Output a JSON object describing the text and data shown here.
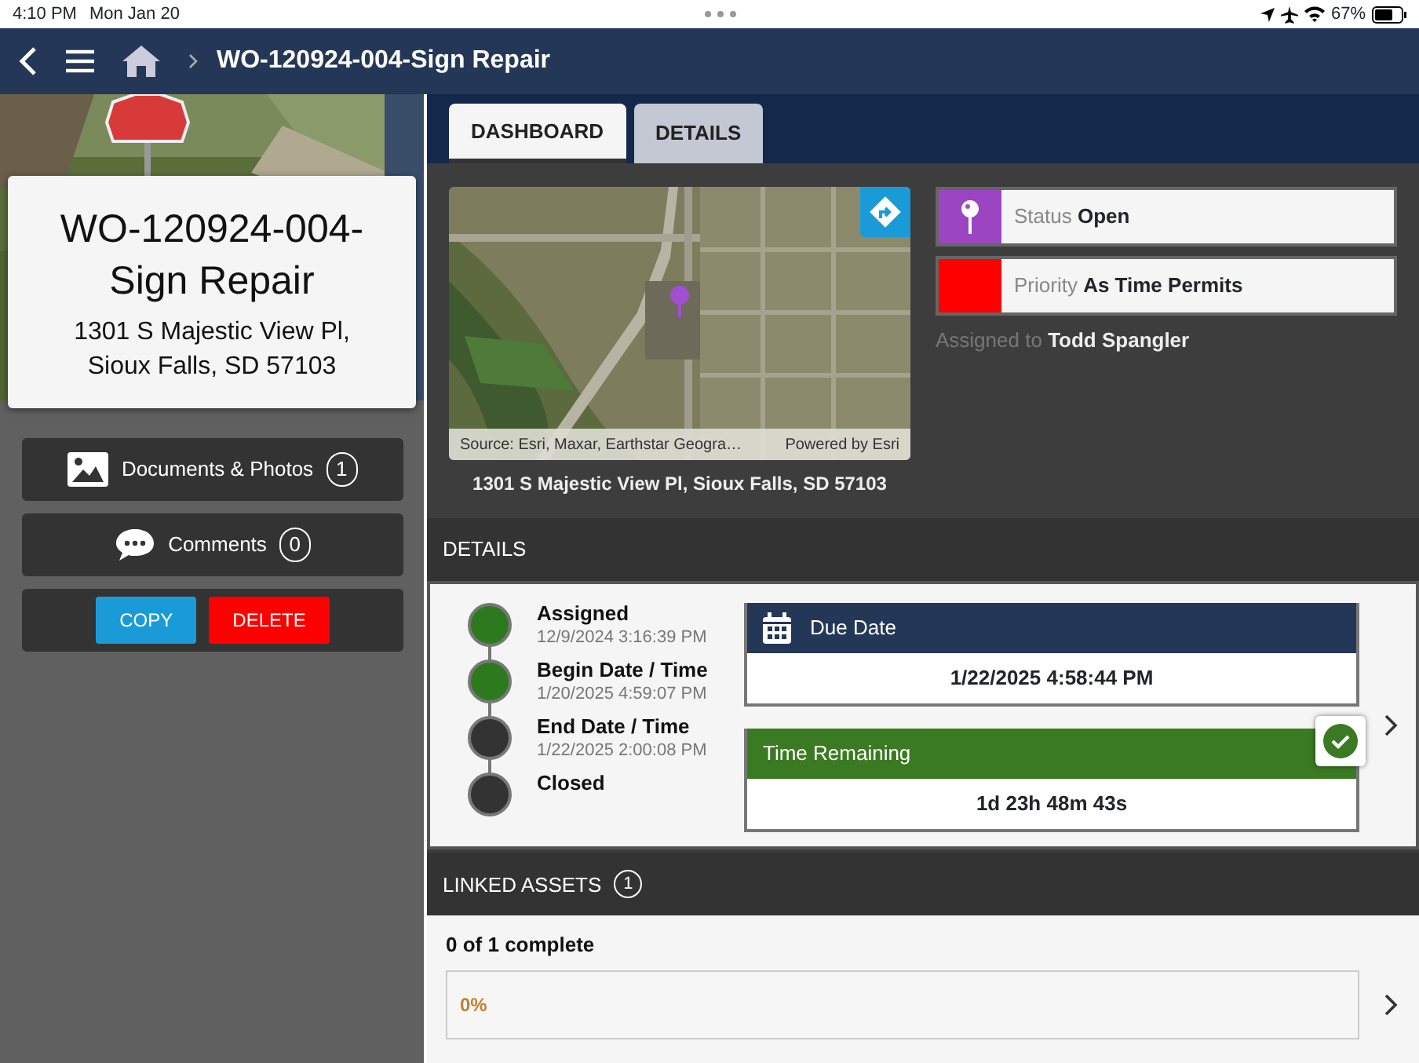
{
  "status_bar": {
    "time": "4:10 PM",
    "date": "Mon Jan 20",
    "battery": "67%"
  },
  "nav": {
    "title": "WO-120924-004-Sign Repair"
  },
  "sidebar": {
    "title": "WO-120924-004-Sign Repair",
    "address": "1301 S Majestic View Pl, Sioux Falls, SD 57103",
    "links": [
      {
        "kind": "photos",
        "label": "Documents & Photos",
        "count": "1"
      },
      {
        "kind": "comments",
        "label": "Comments",
        "count": "0"
      }
    ],
    "actions": [
      {
        "kind": "copy",
        "label": "COPY"
      },
      {
        "kind": "delete",
        "label": "DELETE"
      }
    ]
  },
  "tabs": [
    {
      "label": "DASHBOARD",
      "selected": true
    },
    {
      "label": "DETAILS",
      "selected": false
    }
  ],
  "map": {
    "attribution": "Source: Esri, Maxar, Earthstar Geogra…",
    "powered_by": "Powered by Esri",
    "address": "1301 S Majestic View Pl, Sioux Falls, SD 57103"
  },
  "fields": [
    {
      "kind": "status",
      "label": "Status",
      "value": "Open",
      "color": "#9b45c2"
    },
    {
      "kind": "priority",
      "label": "Priority",
      "value": "As Time Permits",
      "color": "#ff0000"
    }
  ],
  "assigned": {
    "label": "Assigned to",
    "value": "Todd Spangler"
  },
  "details": {
    "header": "DETAILS",
    "steps": [
      {
        "label": "Assigned",
        "date": "12/9/2024 3:16:39 PM",
        "done": true
      },
      {
        "label": "Begin Date / Time",
        "date": "1/20/2025 4:59:07 PM",
        "done": true
      },
      {
        "label": "End Date / Time",
        "date": "1/22/2025 2:00:08 PM",
        "done": false
      },
      {
        "label": "Closed",
        "done": false
      }
    ],
    "due": {
      "label": "Due Date",
      "value": "1/22/2025 4:58:44 PM"
    },
    "remaining": {
      "label": "Time Remaining",
      "value": "1d 23h 48m 43s",
      "checked": true
    }
  },
  "linked_assets": {
    "header": "LINKED ASSETS",
    "count": "1",
    "summary": "0 of 1 complete",
    "level": 0,
    "percent": "0%"
  }
}
